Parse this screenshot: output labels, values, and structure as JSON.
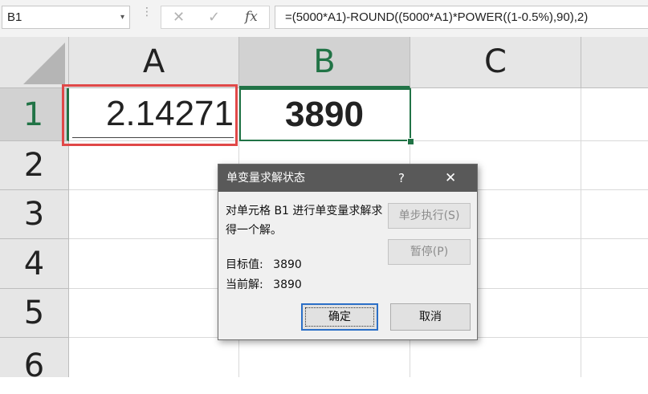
{
  "formula_bar": {
    "name_box": "B1",
    "name_box_dropdown": "▾",
    "separator": "⋮",
    "cancel_glyph": "✕",
    "enter_glyph": "✓",
    "fx_label": "fx",
    "formula": "=(5000*A1)-ROUND((5000*A1)*POWER((1-0.5%),90),2)"
  },
  "sheet": {
    "columns": [
      "A",
      "B",
      "C"
    ],
    "rows": [
      "1",
      "2",
      "3",
      "4",
      "5",
      "6"
    ],
    "cells": {
      "A1": "2.14271",
      "B1": "3890"
    },
    "selected_cell": "B1",
    "accent_color": "#217346",
    "highlight_color": "#e04848"
  },
  "dialog": {
    "title": "单变量求解状态",
    "help_glyph": "?",
    "close_glyph": "✕",
    "message": "对单元格 B1 进行单变量求解求得一个解。",
    "target_label": "目标值:",
    "target_value": "3890",
    "current_label": "当前解:",
    "current_value": "3890",
    "step_button": "单步执行(S)",
    "pause_button": "暂停(P)",
    "ok_button": "确定",
    "cancel_button": "取消"
  }
}
